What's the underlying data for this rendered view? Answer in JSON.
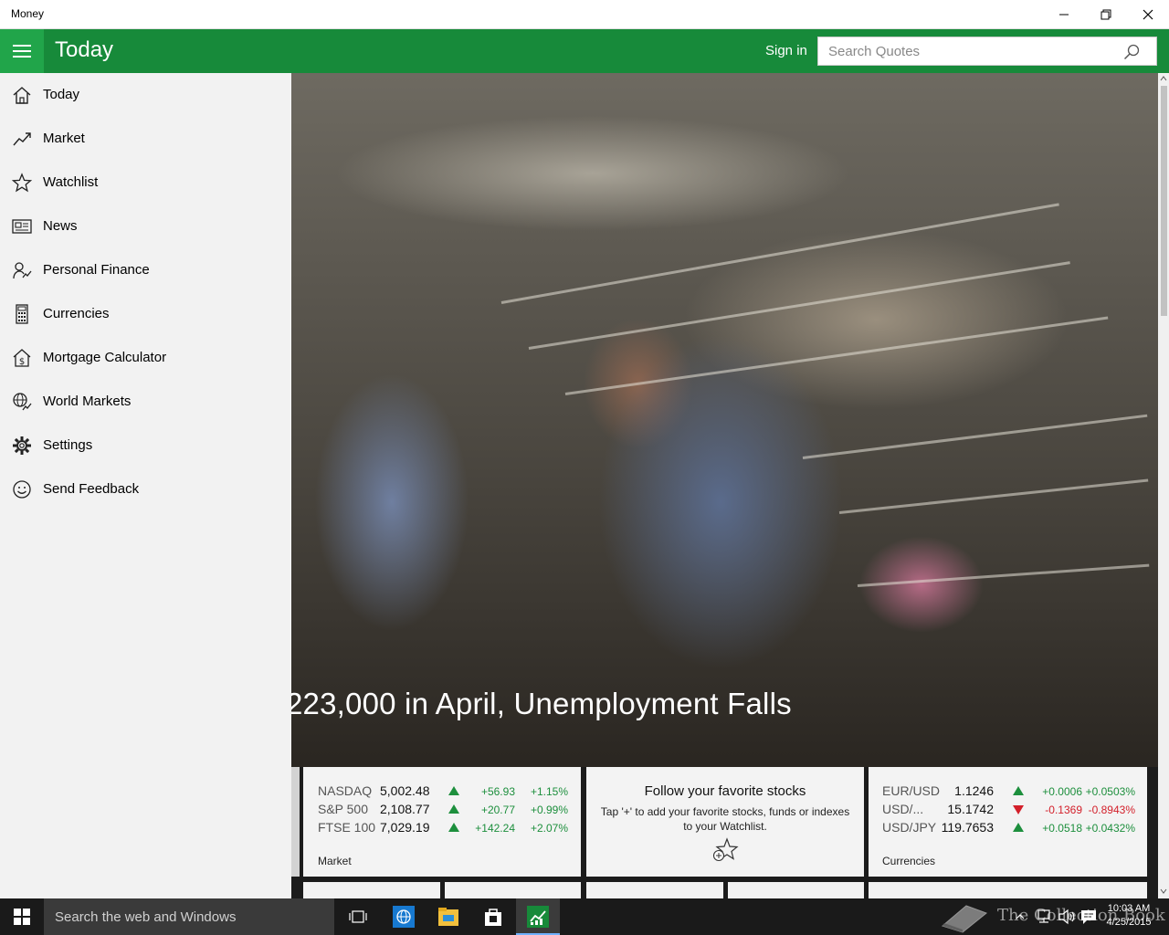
{
  "window": {
    "title": "Money",
    "minimize_icon": "minimize-icon",
    "restore_icon": "restore-icon",
    "close_icon": "close-icon"
  },
  "header": {
    "page_title": "Today",
    "signin_label": "Sign in",
    "search_placeholder": "Search Quotes",
    "brand_color": "#178a3a"
  },
  "sidebar": {
    "items": [
      {
        "label": "Today",
        "icon": "home-icon"
      },
      {
        "label": "Market",
        "icon": "trend-icon"
      },
      {
        "label": "Watchlist",
        "icon": "star-icon"
      },
      {
        "label": "News",
        "icon": "news-icon"
      },
      {
        "label": "Personal Finance",
        "icon": "personal-finance-icon"
      },
      {
        "label": "Currencies",
        "icon": "calculator-icon"
      },
      {
        "label": "Mortgage Calculator",
        "icon": "house-dollar-icon"
      },
      {
        "label": "World Markets",
        "icon": "globe-icon"
      },
      {
        "label": "Settings",
        "icon": "gear-icon"
      },
      {
        "label": "Send Feedback",
        "icon": "smiley-icon"
      }
    ]
  },
  "hero": {
    "headline": "223,000 in April, Unemployment Falls"
  },
  "market_tile": {
    "label": "Market",
    "rows": [
      {
        "name": "NASDAQ",
        "value": "5,002.48",
        "change": "+56.93",
        "pct": "+1.15%",
        "direction": "up"
      },
      {
        "name": "S&P 500",
        "value": "2,108.77",
        "change": "+20.77",
        "pct": "+0.99%",
        "direction": "up"
      },
      {
        "name": "FTSE 100",
        "value": "7,029.19",
        "change": "+142.24",
        "pct": "+2.07%",
        "direction": "up"
      }
    ]
  },
  "watchlist_tile": {
    "title": "Follow your favorite stocks",
    "body": "Tap '+' to add your favorite stocks, funds or indexes to your Watchlist.",
    "icon": "star-add-icon"
  },
  "currencies_tile": {
    "label": "Currencies",
    "rows": [
      {
        "name": "EUR/USD",
        "value": "1.1246",
        "change": "+0.0006",
        "pct": "+0.0503%",
        "direction": "up"
      },
      {
        "name": "USD/...",
        "value": "15.1742",
        "change": "-0.1369",
        "pct": "-0.8943%",
        "direction": "down"
      },
      {
        "name": "USD/JPY",
        "value": "119.7653",
        "change": "+0.0518",
        "pct": "+0.0432%",
        "direction": "up"
      }
    ]
  },
  "taskbar": {
    "search_text": "Search the web and Windows",
    "time": "10:03 AM",
    "date": "4/25/2015",
    "watermark": "The Collection Book"
  }
}
